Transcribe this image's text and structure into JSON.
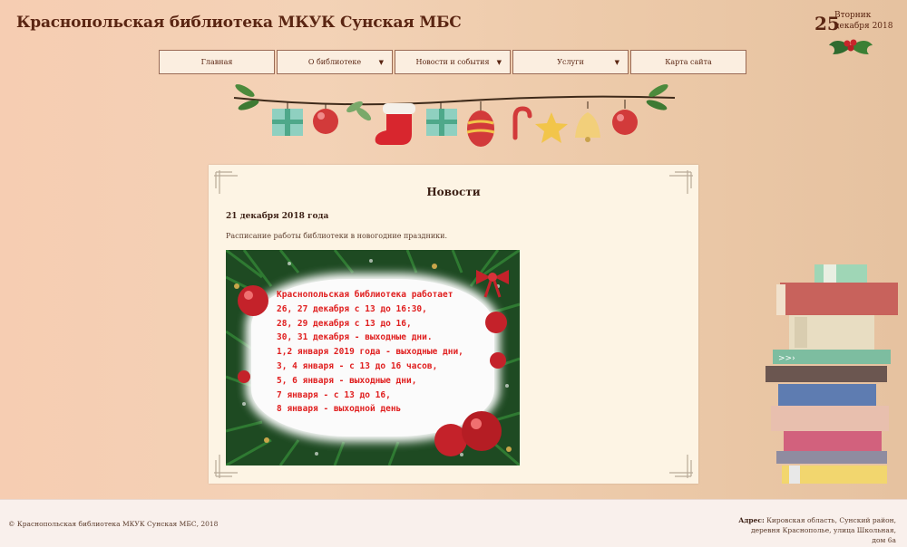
{
  "site": {
    "title": "Краснопольская библиотека МКУК Сунская МБС"
  },
  "date": {
    "day": "25",
    "weekday": "Вторник",
    "month_year": "декабря 2018"
  },
  "nav": {
    "items": [
      {
        "label": "Главная",
        "has_dropdown": false
      },
      {
        "label": "О библиотеке",
        "has_dropdown": true
      },
      {
        "label": "Новости и события",
        "has_dropdown": true
      },
      {
        "label": "Услуги",
        "has_dropdown": true
      },
      {
        "label": "Карта сайта",
        "has_dropdown": false
      }
    ],
    "dropdown_glyph": "▼"
  },
  "main": {
    "title": "Новости",
    "news": {
      "date": "21 декабря 2018 года",
      "text": "Расписание работы библиотеки в новогодние праздники.",
      "card_lines": [
        "Краснопольская библиотека работает",
        "26, 27 декабря с 13 до 16:30,",
        "28, 29 декабря с 13 до 16,",
        "30, 31 декабря - выходные дни.",
        "1,2 января 2019 года - выходные дни,",
        "3, 4 января - с 13 до 16 часов,",
        "5, 6 января - выходные дни,",
        "7 января - с 13 до 16,",
        "8 января - выходной день"
      ]
    }
  },
  "footer": {
    "copyright": "© Краснопольская библиотека МКУК Сунская МБС, 2018",
    "address_label": "Адрес:",
    "address_text": "Кировская область, Сунский район, деревня Краснополье, улица Школьная, дом 6а"
  },
  "colors": {
    "accent": "#5a2512",
    "card_text": "#e02020",
    "panel_bg": "#fdf4e4"
  }
}
